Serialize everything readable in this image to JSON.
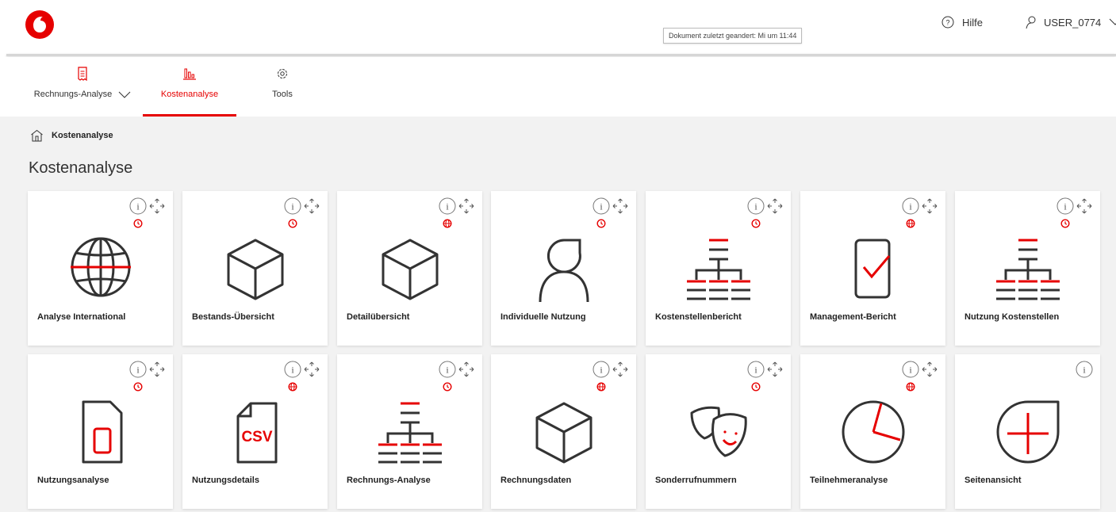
{
  "header": {
    "doc_status": "Dokument zuletzt geandert: Mi um 11:44",
    "help_label": "Hilfe",
    "user_label": "USER_0774"
  },
  "nav": {
    "items": [
      {
        "label": "Rechnungs-Analyse",
        "icon": "invoice-icon",
        "active": false
      },
      {
        "label": "Kostenanalyse",
        "icon": "bar-chart-icon",
        "active": true
      },
      {
        "label": "Tools",
        "icon": "gear-icon",
        "active": false
      }
    ]
  },
  "breadcrumb": {
    "label": "Kostenanalyse",
    "icon": "home-icon"
  },
  "page": {
    "title": "Kostenanalyse"
  },
  "cards": [
    {
      "label": "Analyse International",
      "icon": "globe-icon",
      "badge": "clock-badge-icon"
    },
    {
      "label": "Bestands-Übersicht",
      "icon": "box-icon",
      "badge": "clock-badge-icon"
    },
    {
      "label": "Detailübersicht",
      "icon": "box-icon",
      "badge": "globe-badge-icon"
    },
    {
      "label": "Individuelle Nutzung",
      "icon": "person-icon",
      "badge": "clock-badge-icon"
    },
    {
      "label": "Kostenstellenbericht",
      "icon": "hierarchy-icon",
      "badge": "clock-badge-icon"
    },
    {
      "label": "Management-Bericht",
      "icon": "phone-check-icon",
      "badge": "globe-badge-icon"
    },
    {
      "label": "Nutzung Kostenstellen",
      "icon": "hierarchy-icon",
      "badge": "clock-badge-icon"
    },
    {
      "label": "Nutzungsanalyse",
      "icon": "sim-card-icon",
      "badge": "clock-badge-icon"
    },
    {
      "label": "Nutzungsdetails",
      "icon": "csv-file-icon",
      "badge": "globe-badge-icon",
      "icon_text": "CSV"
    },
    {
      "label": "Rechnungs-Analyse",
      "icon": "hierarchy-icon",
      "badge": "clock-badge-icon"
    },
    {
      "label": "Rechnungsdaten",
      "icon": "box-icon",
      "badge": "globe-badge-icon"
    },
    {
      "label": "Sonderrufnummern",
      "icon": "masks-icon",
      "badge": "clock-badge-icon"
    },
    {
      "label": "Teilnehmeranalyse",
      "icon": "pie-icon",
      "badge": "globe-badge-icon"
    },
    {
      "label": "Seitenansicht",
      "icon": "plus-drop-icon",
      "badge": ""
    }
  ],
  "colors": {
    "brand": "#e60000",
    "background": "#f2f2f2",
    "card": "#ffffff"
  }
}
